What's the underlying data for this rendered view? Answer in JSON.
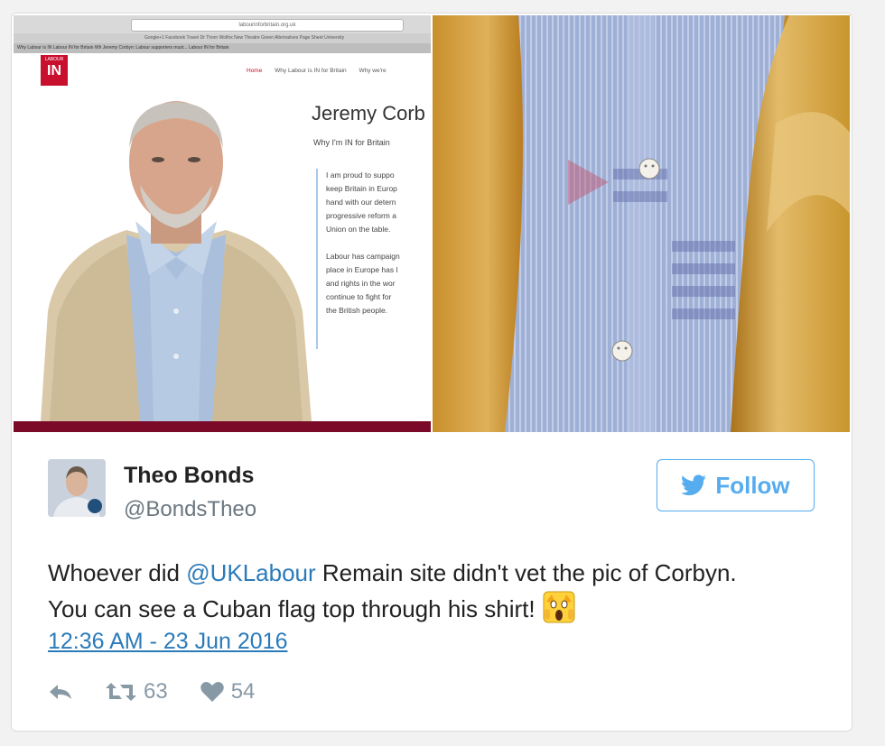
{
  "screenshot": {
    "url_text": "labourinforbritain.org.uk",
    "bookmarks_text": "Google+1   Facebook   Travel   Dr Thorn   Wolfox   New Theatre   Green Alternatives   Page Sheet   University",
    "tabs_text": "Why Labour is IN   Labour IN for Britain   Wh   Jeremy Corbyn: Labour supporters must...   Labour IN for Britain",
    "logo_small": "LABOUR",
    "logo_text": "IN",
    "nav": [
      "Home",
      "Why Labour is IN for Britain",
      "Why we're"
    ],
    "heading": "Jeremy Corb",
    "subheading": "Why I'm IN for Britain",
    "quote": "I am proud to suppo\nkeep Britain in Europ\nhand with our detern\nprogressive reform a\nUnion on the table.\n\nLabour has campaign\nplace in Europe has l\nand rights in the wor\ncontinue to fight for\nthe British people."
  },
  "tweet": {
    "display_name": "Theo Bonds",
    "handle": "@BondsTheo",
    "follow_label": "Follow",
    "text_before": "Whoever did ",
    "mention": "@UKLabour",
    "text_after": " Remain site didn't vet the pic of Corbyn. You can see a Cuban flag top through his shirt!",
    "timestamp": "12:36 AM - 23 Jun 2016",
    "retweets": "63",
    "likes": "54"
  },
  "colors": {
    "accent": "#55acee",
    "link": "#2b7bb9",
    "labour_red": "#c8102e"
  },
  "icons": [
    "reply-icon",
    "retweet-icon",
    "heart-icon",
    "twitter-bird-icon",
    "screaming-face-emoji"
  ]
}
